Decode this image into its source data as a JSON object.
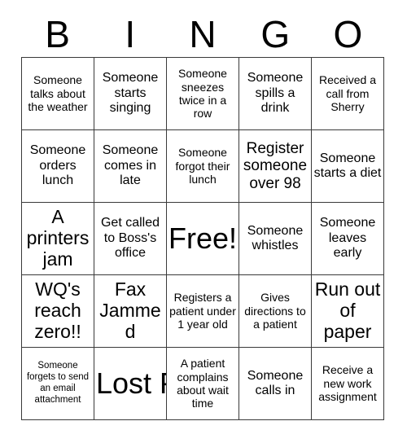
{
  "card": {
    "header_letters": [
      "B",
      "I",
      "N",
      "G",
      "O"
    ],
    "rows": [
      [
        {
          "text": "Someone talks about the weather",
          "size": "sm"
        },
        {
          "text": "Someone starts singing",
          "size": "md"
        },
        {
          "text": "Someone sneezes twice in a row",
          "size": "sm"
        },
        {
          "text": "Someone spills a drink",
          "size": "md"
        },
        {
          "text": "Received a call from Sherry",
          "size": "sm"
        }
      ],
      [
        {
          "text": "Someone orders lunch",
          "size": "md"
        },
        {
          "text": "Someone comes in late",
          "size": "md"
        },
        {
          "text": "Someone forgot their lunch",
          "size": "sm"
        },
        {
          "text": "Register someone over 98",
          "size": "lg"
        },
        {
          "text": "Someone starts a diet",
          "size": "md"
        }
      ],
      [
        {
          "text": "A printers jam",
          "size": "xl"
        },
        {
          "text": "Get called to Boss's office",
          "size": "md"
        },
        {
          "text": "Free!",
          "size": "xxl"
        },
        {
          "text": "Someone whistles",
          "size": "md"
        },
        {
          "text": "Someone leaves early",
          "size": "md"
        }
      ],
      [
        {
          "text": "WQ's reach zero!!",
          "size": "xl"
        },
        {
          "text": "Fax Jammed",
          "size": "xl"
        },
        {
          "text": "Registers a patient under 1 year old",
          "size": "sm"
        },
        {
          "text": "Gives directions to a patient",
          "size": "sm"
        },
        {
          "text": "Run out of paper",
          "size": "xl"
        }
      ],
      [
        {
          "text": "Someone forgets to send an email attachment",
          "size": "xs"
        },
        {
          "text": "Lost Pen",
          "size": "xxl"
        },
        {
          "text": "A patient complains about wait time",
          "size": "sm"
        },
        {
          "text": "Someone calls in",
          "size": "md"
        },
        {
          "text": "Receive a new work assignment",
          "size": "sm"
        }
      ]
    ]
  },
  "colors": {
    "background": "#ffffff",
    "text": "#000000",
    "border": "#3a3a3a"
  }
}
